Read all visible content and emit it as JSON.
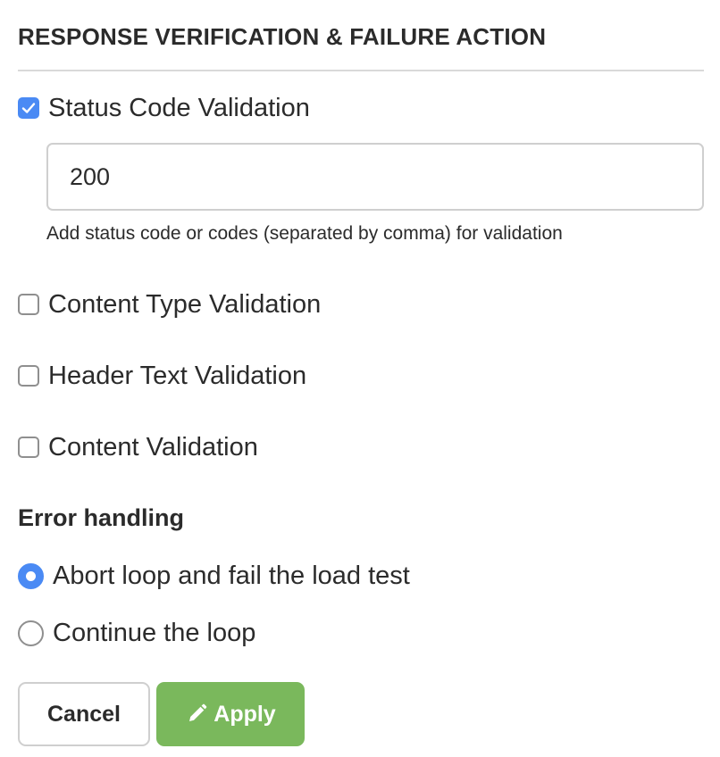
{
  "section": {
    "title": "RESPONSE VERIFICATION & FAILURE ACTION"
  },
  "validations": [
    {
      "label": "Status Code Validation",
      "checked": true
    },
    {
      "label": "Content Type Validation",
      "checked": false
    },
    {
      "label": "Header Text Validation",
      "checked": false
    },
    {
      "label": "Content Validation",
      "checked": false
    }
  ],
  "status_code": {
    "value": "200",
    "help_text": "Add status code or codes (separated by comma) for validation"
  },
  "error_handling": {
    "heading": "Error handling",
    "options": [
      {
        "label": "Abort loop and fail the load test",
        "selected": true
      },
      {
        "label": "Continue the loop",
        "selected": false
      }
    ]
  },
  "buttons": {
    "cancel_label": "Cancel",
    "apply_label": "Apply",
    "apply_icon": "pencil-icon"
  },
  "colors": {
    "accent_blue": "#4a8af4",
    "apply_green": "#7ab85c"
  }
}
